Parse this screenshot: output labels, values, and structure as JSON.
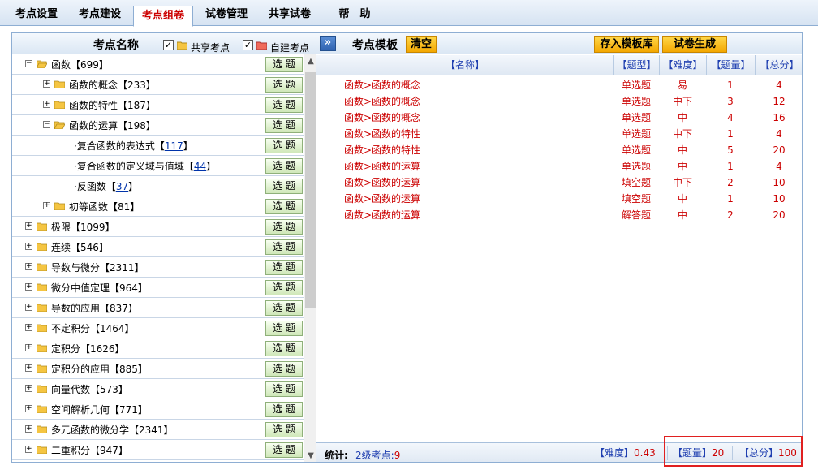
{
  "tabs": [
    {
      "label": "考点设置",
      "active": false
    },
    {
      "label": "考点建设",
      "active": false
    },
    {
      "label": "考点组卷",
      "active": true
    },
    {
      "label": "试卷管理",
      "active": false
    },
    {
      "label": "共享试卷",
      "active": false
    },
    {
      "label": "帮　助",
      "active": false
    }
  ],
  "left": {
    "title": "考点名称",
    "shared_label": "共享考点",
    "custom_label": "自建考点",
    "select_label": "选 题",
    "tree": [
      {
        "level": 0,
        "toggle": "−",
        "folder": "open",
        "label": "函数【699】"
      },
      {
        "level": 1,
        "toggle": "+",
        "folder": "closed",
        "label": "函数的概念【233】"
      },
      {
        "level": 1,
        "toggle": "+",
        "folder": "closed",
        "label": "函数的特性【187】"
      },
      {
        "level": 1,
        "toggle": "−",
        "folder": "open",
        "label": "函数的运算【198】"
      },
      {
        "level": 2,
        "toggle": "",
        "folder": "",
        "label": "·复合函数的表达式【",
        "link": "117",
        "suffix": "】"
      },
      {
        "level": 2,
        "toggle": "",
        "folder": "",
        "label": "·复合函数的定义域与值域【",
        "link": "44",
        "suffix": "】"
      },
      {
        "level": 2,
        "toggle": "",
        "folder": "",
        "label": "·反函数【",
        "link": "37",
        "suffix": "】"
      },
      {
        "level": 1,
        "toggle": "+",
        "folder": "closed",
        "label": "初等函数【81】"
      },
      {
        "level": 0,
        "toggle": "+",
        "folder": "closed",
        "label": "极限【1099】"
      },
      {
        "level": 0,
        "toggle": "+",
        "folder": "closed",
        "label": "连续【546】"
      },
      {
        "level": 0,
        "toggle": "+",
        "folder": "closed",
        "label": "导数与微分【2311】"
      },
      {
        "level": 0,
        "toggle": "+",
        "folder": "closed",
        "label": "微分中值定理【964】"
      },
      {
        "level": 0,
        "toggle": "+",
        "folder": "closed",
        "label": "导数的应用【837】"
      },
      {
        "level": 0,
        "toggle": "+",
        "folder": "closed",
        "label": "不定积分【1464】"
      },
      {
        "level": 0,
        "toggle": "+",
        "folder": "closed",
        "label": "定积分【1626】"
      },
      {
        "level": 0,
        "toggle": "+",
        "folder": "closed",
        "label": "定积分的应用【885】"
      },
      {
        "level": 0,
        "toggle": "+",
        "folder": "closed",
        "label": "向量代数【573】"
      },
      {
        "level": 0,
        "toggle": "+",
        "folder": "closed",
        "label": "空间解析几何【771】"
      },
      {
        "level": 0,
        "toggle": "+",
        "folder": "closed",
        "label": "多元函数的微分学【2341】"
      },
      {
        "level": 0,
        "toggle": "+",
        "folder": "closed",
        "label": "二重积分【947】"
      }
    ]
  },
  "right": {
    "expand_glyph": "»",
    "title": "考点模板",
    "clear_label": "清空",
    "save_template_label": "存入模板库",
    "generate_label": "试卷生成",
    "columns": [
      "【名称】",
      "【题型】",
      "【难度】",
      "【题量】",
      "【总分】"
    ],
    "rows": [
      [
        "函数>函数的概念",
        "单选题",
        "易",
        "1",
        "4"
      ],
      [
        "函数>函数的概念",
        "单选题",
        "中下",
        "3",
        "12"
      ],
      [
        "函数>函数的概念",
        "单选题",
        "中",
        "4",
        "16"
      ],
      [
        "函数>函数的特性",
        "单选题",
        "中下",
        "1",
        "4"
      ],
      [
        "函数>函数的特性",
        "单选题",
        "中",
        "5",
        "20"
      ],
      [
        "函数>函数的运算",
        "单选题",
        "中",
        "1",
        "4"
      ],
      [
        "函数>函数的运算",
        "填空题",
        "中下",
        "2",
        "10"
      ],
      [
        "函数>函数的运算",
        "填空题",
        "中",
        "1",
        "10"
      ],
      [
        "函数>函数的运算",
        "解答题",
        "中",
        "2",
        "20"
      ]
    ],
    "footer": {
      "stats_label": "统计:",
      "level2_label": "2级考点:",
      "level2_value": "9",
      "difficulty_label": "【难度】",
      "difficulty_value": "0.43",
      "count_label": "【题量】",
      "count_value": "20",
      "score_label": "【总分】",
      "score_value": "100"
    }
  },
  "colors": {
    "accent_red": "#cc0000",
    "header_blue": "#1f3fb0",
    "orange": "#f3a700",
    "highlight": "#e02020"
  }
}
